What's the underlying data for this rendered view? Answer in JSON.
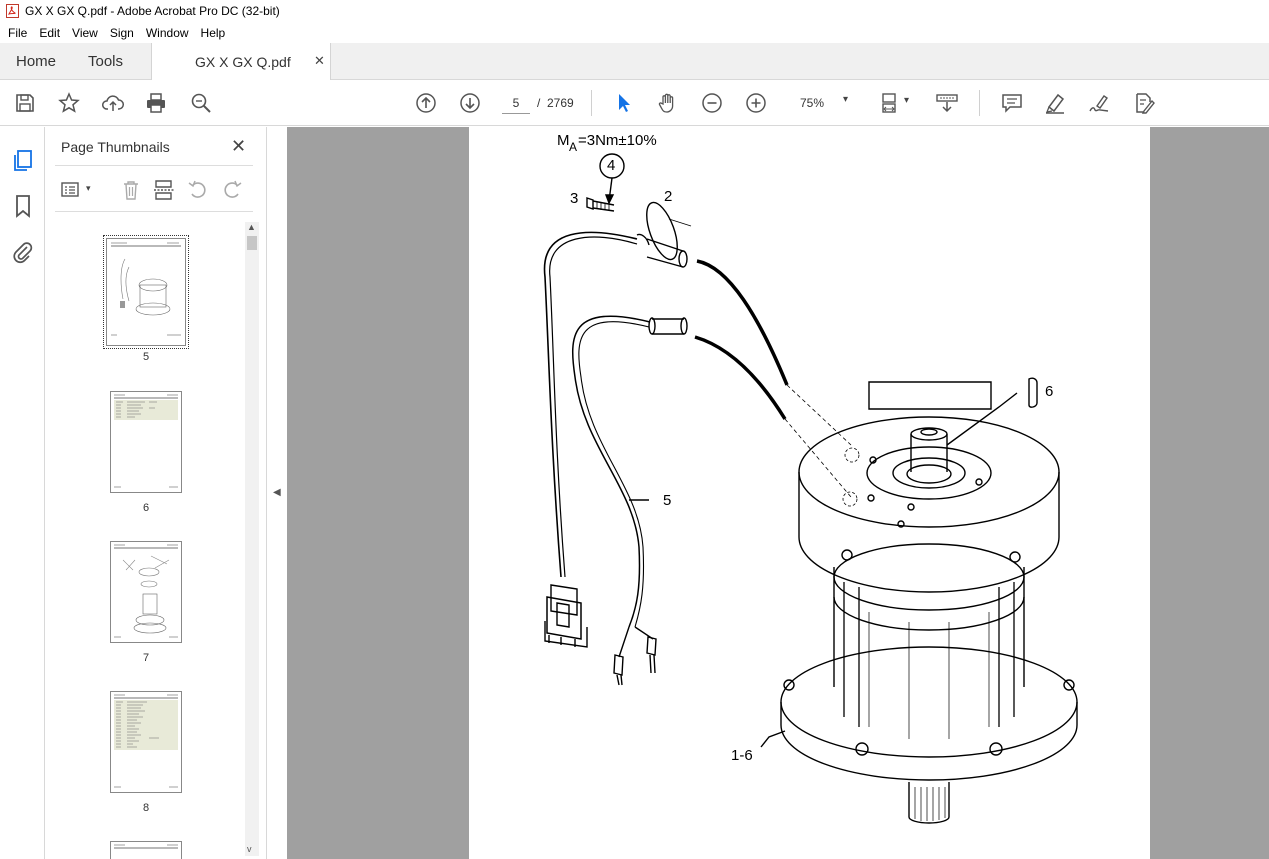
{
  "window": {
    "title": "GX X  GX Q.pdf - Adobe Acrobat Pro DC (32-bit)"
  },
  "menu": [
    "File",
    "Edit",
    "View",
    "Sign",
    "Window",
    "Help"
  ],
  "tabs": {
    "home": "Home",
    "tools": "Tools",
    "document": "GX X  GX Q.pdf",
    "close_glyph": "✕"
  },
  "toolbar": {
    "icons": [
      "save-icon",
      "bookmark-star-icon",
      "upload-icon",
      "print-icon",
      "zoom-search-icon",
      "page-up-icon",
      "page-down-icon",
      "select-arrow-icon",
      "hand-icon",
      "zoom-out-icon",
      "zoom-in-icon",
      "page-fit-icon",
      "scroll-mode-icon",
      "comment-icon",
      "highlight-icon",
      "sign-icon",
      "edit-pdf-icon"
    ],
    "page_current": "5",
    "page_separator": "/",
    "page_total": "2769",
    "zoom": "75%",
    "zoom_arrow": "▾",
    "accent_color": "#1473e6"
  },
  "thumbnails_panel": {
    "title": "Page Thumbnails",
    "close_glyph": "✕",
    "scroll_up": "▲",
    "scroll_down": "v",
    "pages": [
      {
        "label": "5",
        "selected": true
      },
      {
        "label": "6",
        "selected": false
      },
      {
        "label": "7",
        "selected": false
      },
      {
        "label": "8",
        "selected": false
      }
    ]
  },
  "collapse_arrow": "◀",
  "document_page": {
    "torque_label_m": "M",
    "torque_label_sub": "A",
    "torque_label_rest": "=3Nm±10%",
    "callouts": {
      "c4": "4",
      "c3": "3",
      "c2": "2",
      "c6": "6",
      "c5": "5",
      "c16": "1-6"
    }
  }
}
